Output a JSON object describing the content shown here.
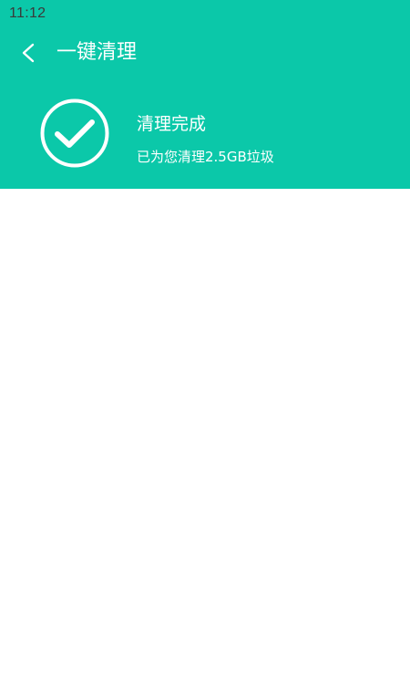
{
  "status_bar": {
    "time": "11:12"
  },
  "toolbar": {
    "back_icon": "chevron-left-icon",
    "title": "一键清理"
  },
  "result": {
    "icon": "check-circle-icon",
    "title": "清理完成",
    "subtitle": "已为您清理2.5GB垃圾"
  },
  "colors": {
    "accent": "#0bc8a9",
    "background": "#ffffff",
    "status_text": "#3a3a3a",
    "header_text": "#ffffff"
  }
}
